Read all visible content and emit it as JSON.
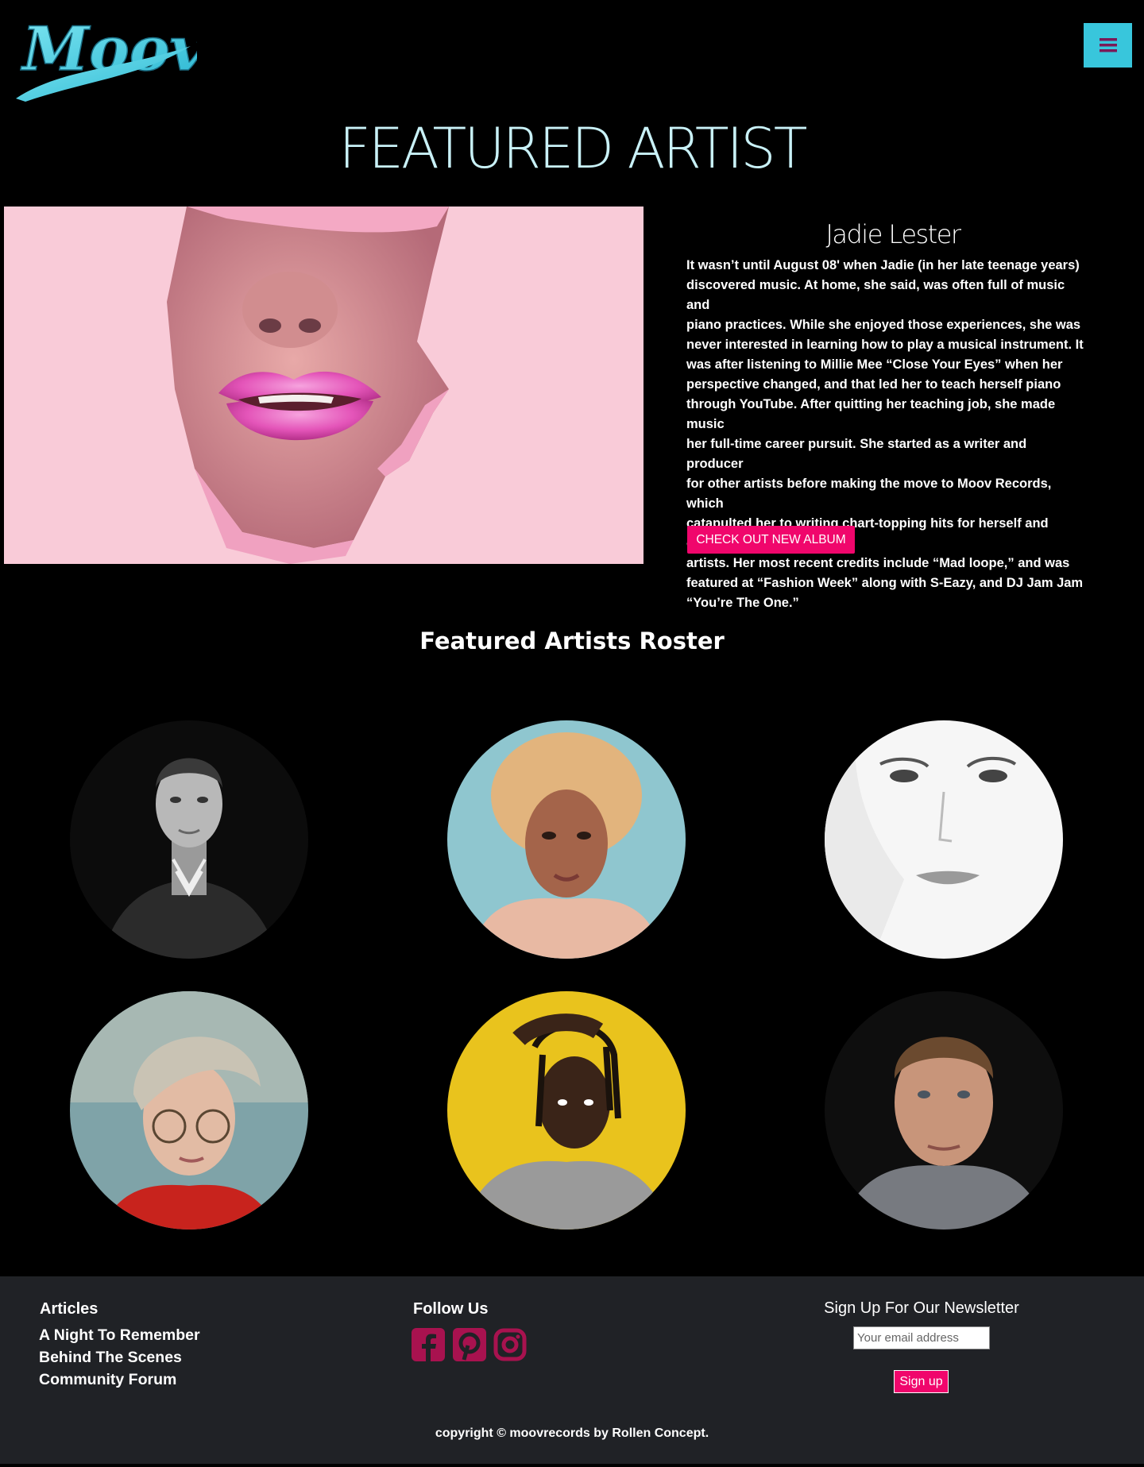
{
  "brand": {
    "logo_text": "Moov"
  },
  "header": {
    "menu_icon": "hamburger-icon",
    "menu_color": "#38c6dc"
  },
  "hero": {
    "title": "FEATURED ARTIST"
  },
  "featured_artist": {
    "name": "Jadie Lester",
    "bio_lines": [
      "It wasn’t until August 08' when Jadie (in her late teenage years)",
      "discovered music. At home, she said, was often full of music and",
      "piano practices. While she enjoyed those experiences, she was",
      "never interested in learning how to play a musical instrument. It",
      "was after listening to Millie Mee “Close Your Eyes” when her",
      "perspective changed, and that led her to teach herself piano",
      "through YouTube. After quitting her teaching job, she made music",
      "her full-time career pursuit. She started as a writer and producer",
      "for other artists before making the move to Moov Records, which",
      "catapulted her to writing chart-topping hits for herself and other",
      "artists. Her most recent credits include “Mad loope,” and was",
      "featured at “Fashion Week” along with S-Eazy, and DJ Jam Jam",
      "“You’re The One.”"
    ],
    "cta_label": "CHECK OUT NEW ALBUM"
  },
  "roster": {
    "title": "Featured Artists Roster"
  },
  "footer": {
    "articles": {
      "title": "Articles",
      "links": [
        "A Night To Remember",
        "Behind The Scenes",
        "Community Forum"
      ]
    },
    "follow": {
      "title": "Follow Us",
      "icons": [
        "facebook-icon",
        "pinterest-icon",
        "instagram-icon"
      ],
      "icon_color": "#a8124f"
    },
    "newsletter": {
      "title": "Sign Up For Our Newsletter",
      "placeholder": "Your email address",
      "button": "Sign up"
    },
    "copyright": "copyright © moovrecords by Rollen Concept."
  },
  "colors": {
    "accent": "#f0066c",
    "cyan": "#38c6dc",
    "footer_bg": "#202226"
  }
}
